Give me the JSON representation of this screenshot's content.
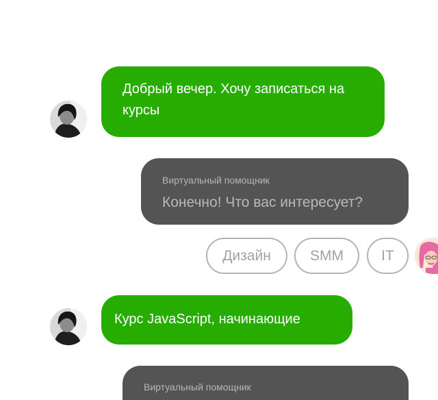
{
  "messages": [
    {
      "sender": "user",
      "text": "Добрый вечер. Хочу записаться на курсы"
    },
    {
      "sender": "bot",
      "sender_label": "Виртуальный помощник",
      "text": "Конечно! Что вас интересует?"
    },
    {
      "sender": "user",
      "text": "Курс JavaScript, начинающие"
    },
    {
      "sender": "bot",
      "sender_label": "Виртуальный помощник",
      "text": ""
    }
  ],
  "quick_replies": [
    "Дизайн",
    "SMM",
    "IT"
  ],
  "colors": {
    "user_bubble": "#27ad02",
    "bot_bubble": "#545454",
    "chip_border": "#b3b3b3",
    "bot_avatar_bg": "#fbe7d6"
  },
  "icons": {
    "user_avatar": "user-photo-avatar",
    "bot_avatar": "memoji-pink-hair-avatar"
  }
}
